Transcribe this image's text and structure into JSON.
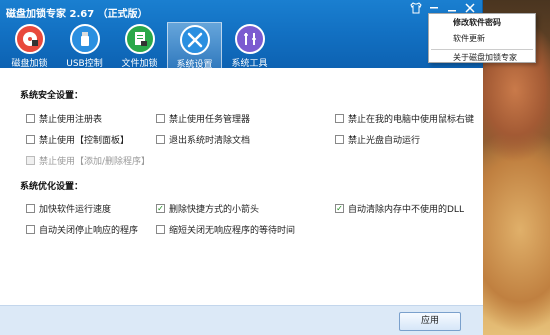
{
  "window": {
    "title": "磁盘加锁专家 2.67 （正式版）",
    "controls": [
      "shirt-icon",
      "menu-icon",
      "minimize-icon",
      "close-icon"
    ]
  },
  "tabs": [
    {
      "label": "磁盘加锁",
      "icon": "disk-lock-icon",
      "color": "#e8493c"
    },
    {
      "label": "USB控制",
      "icon": "usb-icon",
      "color": "#2a8fe0"
    },
    {
      "label": "文件加锁",
      "icon": "file-lock-icon",
      "color": "#2aa84a"
    },
    {
      "label": "系统设置",
      "icon": "settings-tools-icon",
      "color": "#2a8fe0",
      "active": true
    },
    {
      "label": "系统工具",
      "icon": "system-tools-icon",
      "color": "#7b5bd0"
    }
  ],
  "security": {
    "title": "系统安全设置：",
    "options": [
      {
        "label": "禁止使用注册表",
        "checked": false
      },
      {
        "label": "禁止使用任务管理器",
        "checked": false
      },
      {
        "label": "禁止在我的电脑中使用鼠标右键",
        "checked": false
      },
      {
        "label": "禁止使用【控制面板】",
        "checked": false
      },
      {
        "label": "退出系统时清除文档",
        "checked": false
      },
      {
        "label": "禁止光盘自动运行",
        "checked": false
      },
      {
        "label": "禁止使用【添加/删除程序】",
        "checked": false,
        "disabled": true
      }
    ]
  },
  "optimize": {
    "title": "系统优化设置：",
    "options": [
      {
        "label": "加快软件运行速度",
        "checked": false
      },
      {
        "label": "删除快捷方式的小箭头",
        "checked": true
      },
      {
        "label": "自动清除内存中不使用的DLL",
        "checked": true
      },
      {
        "label": "自动关闭停止响应的程序",
        "checked": false
      },
      {
        "label": "缩短关闭无响应程序的等待时间",
        "checked": false
      }
    ]
  },
  "footer": {
    "apply_label": "应用"
  },
  "menu": {
    "items": [
      "修改软件密码",
      "软件更新",
      "关于磁盘加锁专家"
    ]
  },
  "colors": {
    "header": "#1270c2",
    "accent_check": "#1a8a1a",
    "footer_bg": "#dce9f7"
  }
}
